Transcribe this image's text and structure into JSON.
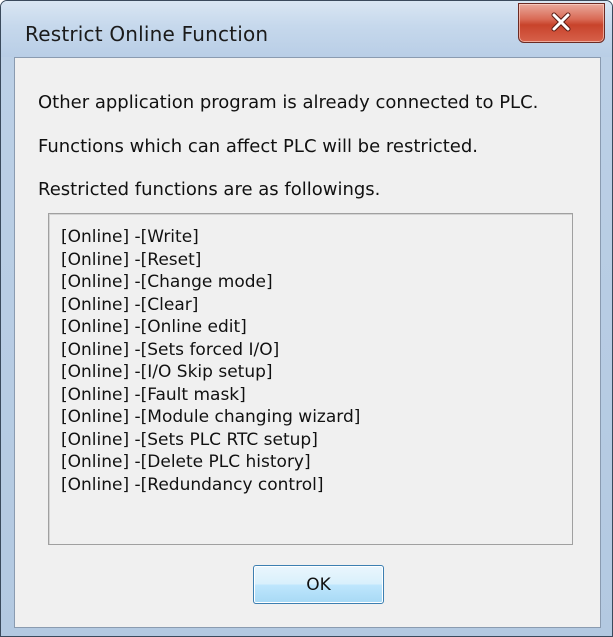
{
  "dialog": {
    "title": "Restrict Online Function",
    "close_icon": "close-icon",
    "messages": [
      "Other application program is already connected to PLC.",
      "Functions which can affect PLC will be restricted.",
      "Restricted functions are as followings."
    ],
    "restricted_functions": [
      "[Online] -[Write]",
      "[Online] -[Reset]",
      "[Online] -[Change mode]",
      "[Online] -[Clear]",
      "[Online] -[Online edit]",
      "[Online] -[Sets forced I/O]",
      "[Online] -[I/O Skip setup]",
      "[Online] -[Fault mask]",
      "[Online] -[Module changing wizard]",
      "[Online] -[Sets PLC RTC setup]",
      "[Online] -[Delete PLC history]",
      "[Online] -[Redundancy control]"
    ],
    "ok_label": "OK"
  },
  "colors": {
    "frame": "#b9cee6",
    "close_button": "#c8432b",
    "ok_button": "#bee6fd",
    "client_background": "#f0f0f0"
  }
}
